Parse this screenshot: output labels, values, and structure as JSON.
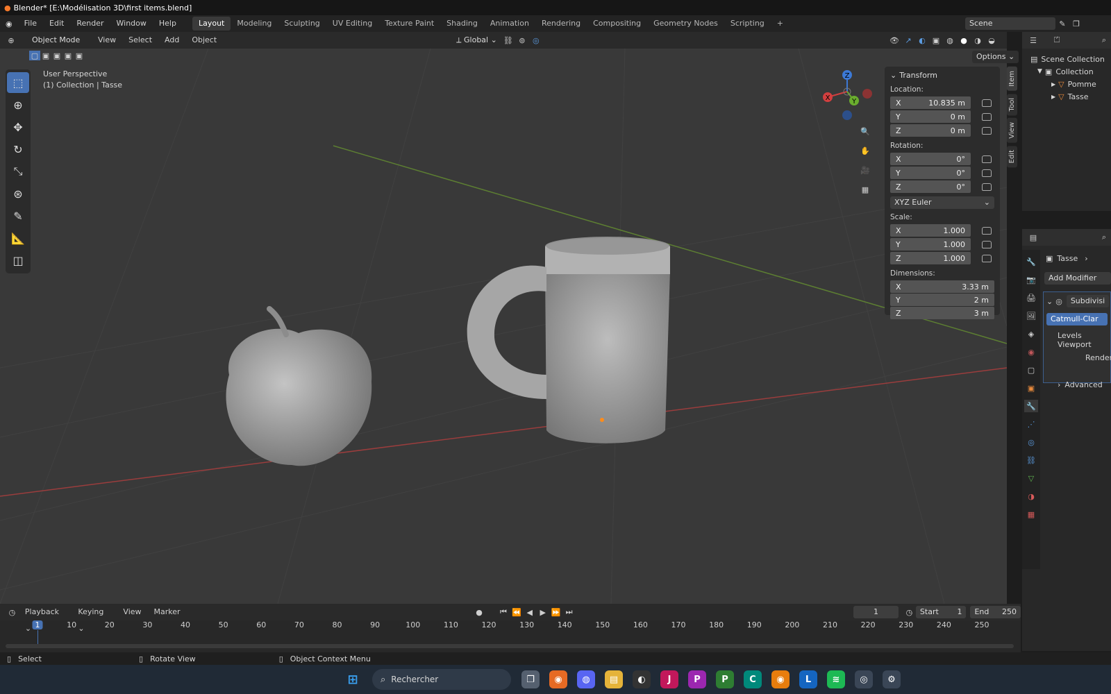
{
  "window": {
    "title": "Blender* [E:\\Modélisation 3D\\first items.blend]"
  },
  "menu": [
    "File",
    "Edit",
    "Render",
    "Window",
    "Help"
  ],
  "workspaces": [
    "Layout",
    "Modeling",
    "Sculpting",
    "UV Editing",
    "Texture Paint",
    "Shading",
    "Animation",
    "Rendering",
    "Compositing",
    "Geometry Nodes",
    "Scripting"
  ],
  "scene_name": "Scene",
  "viewport_header": {
    "mode": "Object Mode",
    "menus": [
      "View",
      "Select",
      "Add",
      "Object"
    ],
    "orientation": "Global",
    "options": "Options"
  },
  "viewport_info": {
    "perspective": "User Perspective",
    "context": "(1) Collection | Tasse"
  },
  "gizmo": {
    "x": "X",
    "y": "Y",
    "z": "Z"
  },
  "transform": {
    "title": "Transform",
    "location_label": "Location:",
    "location": {
      "x": "10.835 m",
      "y": "0 m",
      "z": "0 m"
    },
    "rotation_label": "Rotation:",
    "rotation": {
      "x": "0°",
      "y": "0°",
      "z": "0°"
    },
    "rotation_mode": "XYZ Euler",
    "scale_label": "Scale:",
    "scale": {
      "x": "1.000",
      "y": "1.000",
      "z": "1.000"
    },
    "dimensions_label": "Dimensions:",
    "dimensions": {
      "x": "3.33 m",
      "y": "2 m",
      "z": "3 m"
    },
    "axis_labels": [
      "X",
      "Y",
      "Z"
    ]
  },
  "side_tabs": [
    "Item",
    "Tool",
    "View",
    "Edit"
  ],
  "outliner": {
    "root": "Scene Collection",
    "collection": "Collection",
    "items": [
      "Pomme",
      "Tasse"
    ]
  },
  "properties": {
    "object": "Tasse",
    "add_modifier": "Add Modifier",
    "modifier": "Subdivisi",
    "method": "Catmull-Clar",
    "levels": "Levels Viewport",
    "render": "Render",
    "advanced": "Advanced"
  },
  "timeline": {
    "menus": [
      "Playback",
      "Keying",
      "View",
      "Marker"
    ],
    "current_frame": "1",
    "start_label": "Start",
    "start": "1",
    "end_label": "End",
    "end": "250",
    "ticks": [
      "1",
      "10",
      "20",
      "30",
      "40",
      "50",
      "60",
      "70",
      "80",
      "90",
      "100",
      "110",
      "120",
      "130",
      "140",
      "150",
      "160",
      "170",
      "180",
      "190",
      "200",
      "210",
      "220",
      "230",
      "240",
      "250"
    ]
  },
  "status": {
    "select": "Select",
    "rotate": "Rotate View",
    "context": "Object Context Menu"
  },
  "taskbar": {
    "search": "Rechercher"
  }
}
